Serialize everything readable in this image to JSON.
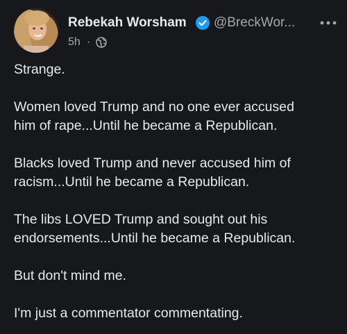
{
  "post": {
    "author_name": "Rebekah Worsham",
    "handle": "@BreckWor...",
    "time": "5h",
    "separator": "·",
    "icons": {
      "verified": "verified-badge-icon",
      "more": "more-options-icon",
      "audience": "globe-icon"
    },
    "colors": {
      "background": "#16181c",
      "text": "#e7e9ea",
      "secondary": "#a5a8ab",
      "verified": "#1d9bf0"
    },
    "paragraphs": [
      [
        "Strange."
      ],
      [
        "Women loved Trump and no one ever accused",
        "him of rape...Until he became a Republican."
      ],
      [
        "Blacks loved Trump and never accused him of",
        "racism...Until he became a Republican."
      ],
      [
        "The libs LOVED Trump and sought out his",
        "endorsements...Until he became a Republican."
      ],
      [
        "But don't mind me."
      ],
      [
        "I'm just a commentator commentating."
      ]
    ]
  }
}
